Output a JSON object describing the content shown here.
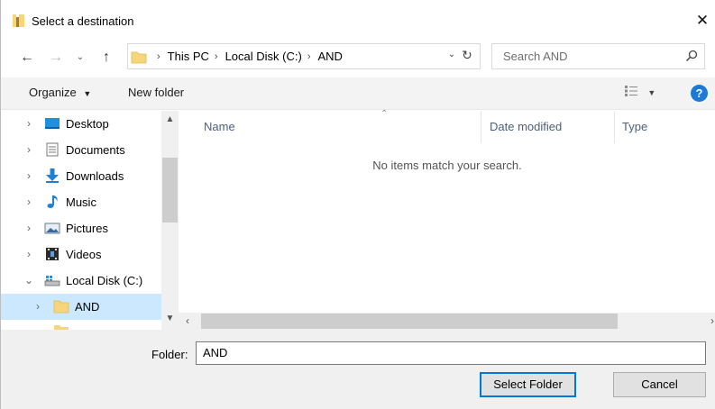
{
  "window": {
    "title": "Select a destination",
    "close_glyph": "✕",
    "icon": "folder-app-icon"
  },
  "nav": {
    "back": "←",
    "forward": "→",
    "recent": "⌄",
    "up": "↑"
  },
  "address": {
    "crumbs": [
      "This PC",
      "Local Disk (C:)",
      "AND"
    ],
    "separator": "›",
    "dropdown": "⌄",
    "refresh": "↻"
  },
  "search": {
    "placeholder": "Search AND"
  },
  "toolbar": {
    "organize_label": "Organize",
    "organize_caret": "▼",
    "new_folder_label": "New folder",
    "view_caret": "▼",
    "help_label": "?"
  },
  "sidebar": {
    "items": [
      {
        "label": "Desktop",
        "icon": "desktop-icon"
      },
      {
        "label": "Documents",
        "icon": "documents-icon"
      },
      {
        "label": "Downloads",
        "icon": "downloads-icon"
      },
      {
        "label": "Music",
        "icon": "music-icon"
      },
      {
        "label": "Pictures",
        "icon": "pictures-icon"
      },
      {
        "label": "Videos",
        "icon": "videos-icon"
      },
      {
        "label": "Local Disk (C:)",
        "icon": "drive-icon",
        "expanded": true
      },
      {
        "label": "AND",
        "icon": "folder-icon",
        "selected": true
      }
    ],
    "chevron_collapsed": "›",
    "chevron_expanded": "⌄"
  },
  "file_list": {
    "columns": [
      "Name",
      "Date modified",
      "Type"
    ],
    "empty_message": "No items match your search."
  },
  "footer": {
    "folder_label": "Folder:",
    "folder_value": "AND",
    "select_button": "Select Folder",
    "cancel_button": "Cancel"
  },
  "colors": {
    "accent": "#0078d7",
    "selection": "#cce8ff",
    "folder": "#f6d67a",
    "help": "#1e7ad7"
  }
}
